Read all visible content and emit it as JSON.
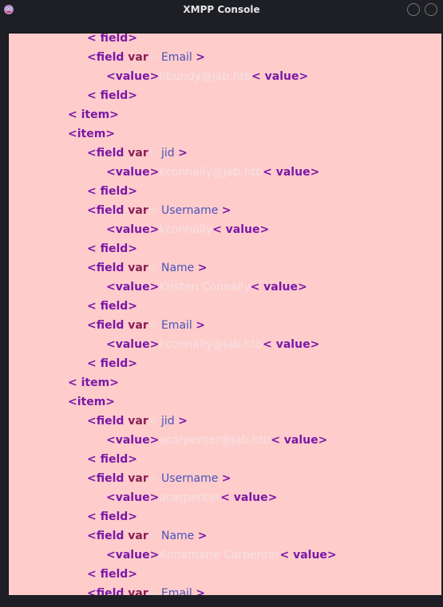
{
  "window": {
    "title": "XMPP Console"
  },
  "lines": [
    {
      "indent": 1,
      "kind": "close",
      "tag": "field"
    },
    {
      "indent": 1,
      "kind": "open",
      "tag": "field",
      "attr": "var",
      "attrval": "Email"
    },
    {
      "indent": 2,
      "kind": "value",
      "text": "hbundy@jab.htb"
    },
    {
      "indent": 1,
      "kind": "close",
      "tag": "field"
    },
    {
      "indent": 0,
      "kind": "close",
      "tag": "item"
    },
    {
      "indent": 0,
      "kind": "plain",
      "tag": "item"
    },
    {
      "indent": 1,
      "kind": "open",
      "tag": "field",
      "attr": "var",
      "attrval": "jid"
    },
    {
      "indent": 2,
      "kind": "value",
      "text": "kconnally@jab.htb"
    },
    {
      "indent": 1,
      "kind": "close",
      "tag": "field"
    },
    {
      "indent": 1,
      "kind": "open",
      "tag": "field",
      "attr": "var",
      "attrval": "Username"
    },
    {
      "indent": 2,
      "kind": "value",
      "text": "kconnally"
    },
    {
      "indent": 1,
      "kind": "close",
      "tag": "field"
    },
    {
      "indent": 1,
      "kind": "open",
      "tag": "field",
      "attr": "var",
      "attrval": "Name"
    },
    {
      "indent": 2,
      "kind": "value",
      "text": "Kristen Connally"
    },
    {
      "indent": 1,
      "kind": "close",
      "tag": "field"
    },
    {
      "indent": 1,
      "kind": "open",
      "tag": "field",
      "attr": "var",
      "attrval": "Email"
    },
    {
      "indent": 2,
      "kind": "value",
      "text": "kconnally@jab.htb"
    },
    {
      "indent": 1,
      "kind": "close",
      "tag": "field"
    },
    {
      "indent": 0,
      "kind": "close",
      "tag": "item"
    },
    {
      "indent": 0,
      "kind": "plain",
      "tag": "item"
    },
    {
      "indent": 1,
      "kind": "open",
      "tag": "field",
      "attr": "var",
      "attrval": "jid"
    },
    {
      "indent": 2,
      "kind": "value",
      "text": "acarpenter@jab.htb"
    },
    {
      "indent": 1,
      "kind": "close",
      "tag": "field"
    },
    {
      "indent": 1,
      "kind": "open",
      "tag": "field",
      "attr": "var",
      "attrval": "Username"
    },
    {
      "indent": 2,
      "kind": "value",
      "text": "acarpenter"
    },
    {
      "indent": 1,
      "kind": "close",
      "tag": "field"
    },
    {
      "indent": 1,
      "kind": "open",
      "tag": "field",
      "attr": "var",
      "attrval": "Name"
    },
    {
      "indent": 2,
      "kind": "value",
      "text": "Annamarie Carpenter"
    },
    {
      "indent": 1,
      "kind": "close",
      "tag": "field"
    },
    {
      "indent": 1,
      "kind": "open",
      "tag": "field",
      "attr": "var",
      "attrval": "Email"
    }
  ],
  "colors": {
    "background": "#ffcccc",
    "tag": "#7a18a6",
    "attribute": "#8b1f55",
    "attribute_value": "#4a54b8",
    "text_value": "#f4e2e2"
  }
}
